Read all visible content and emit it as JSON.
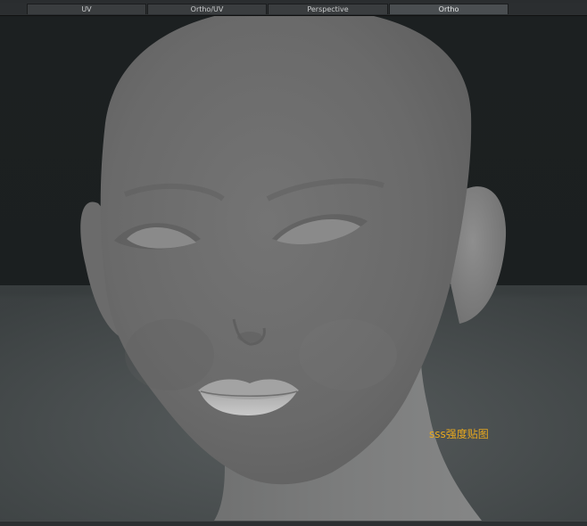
{
  "tabs": [
    {
      "label": "UV"
    },
    {
      "label": "Ortho/UV"
    },
    {
      "label": "Perspective"
    },
    {
      "label": "Ortho",
      "active": true
    }
  ],
  "viewport": {
    "annotation": "sss强度贴图",
    "annotation_color": "#e7a81e",
    "background_color": "#1b1f20",
    "ground_color": "#4a4f50"
  }
}
